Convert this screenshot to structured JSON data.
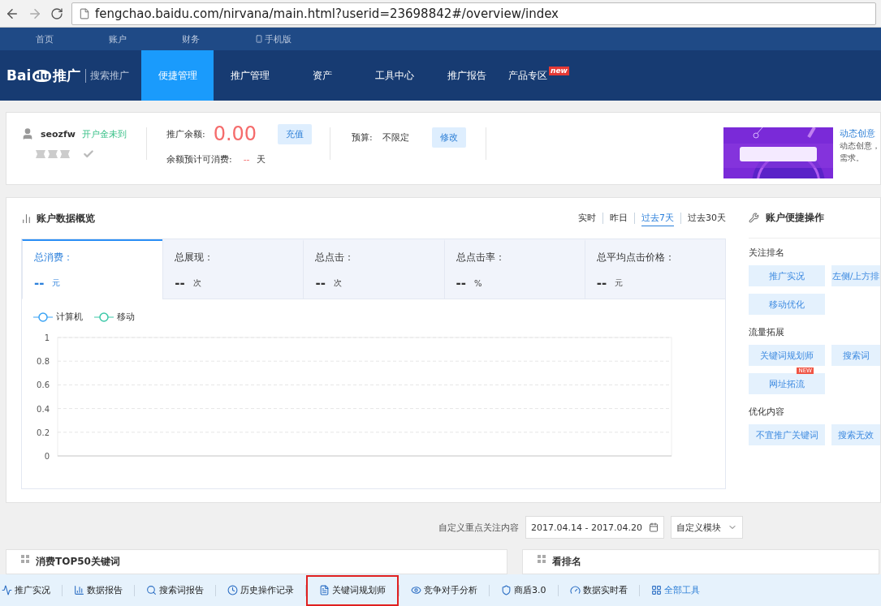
{
  "browser": {
    "url": "fengchao.baidu.com/nirvana/main.html?userid=23698842#/overview/index"
  },
  "top_links": [
    {
      "label": "首页",
      "kind": "text"
    },
    {
      "label": "账户",
      "kind": "text"
    },
    {
      "label": "财务",
      "kind": "text"
    },
    {
      "label": "手机版",
      "kind": "phone"
    }
  ],
  "logo": {
    "part_1": "Bai",
    "part_2": "du",
    "part_3": "推广",
    "subtitle": "搜索推广"
  },
  "nav_tabs": [
    {
      "label": "便捷管理",
      "selected": true
    },
    {
      "label": "推广管理",
      "selected": false
    },
    {
      "label": "资产",
      "selected": false
    },
    {
      "label": "工具中心",
      "selected": false
    },
    {
      "label": "推广报告",
      "selected": false
    },
    {
      "label": "产品专区",
      "selected": false,
      "badge": "new"
    }
  ],
  "account": {
    "username": "seozfw",
    "status": "开户金未到",
    "balance_label": "推广余额:",
    "balance": "0.00",
    "recharge_button": "充值",
    "estimate_label": "余额预计可消费:",
    "estimate_value": "--",
    "estimate_unit": "天",
    "budget_label": "预算:",
    "budget_value": "不限定",
    "edit_button": "修改"
  },
  "promo": {
    "title": "动态创意",
    "line_1": "动态创意，",
    "line_2": "需求。"
  },
  "overview": {
    "title": "账户数据概览",
    "time_ranges": [
      {
        "label": "实时",
        "selected": false
      },
      {
        "label": "昨日",
        "selected": false
      },
      {
        "label": "过去7天",
        "selected": true
      },
      {
        "label": "过去30天",
        "selected": false
      }
    ],
    "metrics": [
      {
        "label": "总消费：",
        "value": "--",
        "unit": "元",
        "selected": true
      },
      {
        "label": "总展现：",
        "value": "--",
        "unit": "次",
        "selected": false
      },
      {
        "label": "总点击：",
        "value": "--",
        "unit": "次",
        "selected": false
      },
      {
        "label": "总点击率：",
        "value": "--",
        "unit": "%",
        "selected": false
      },
      {
        "label": "总平均点击价格：",
        "value": "--",
        "unit": "元",
        "selected": false
      }
    ],
    "legend": [
      {
        "label": "计算机",
        "color": "#3aa3f5"
      },
      {
        "label": "移动",
        "color": "#3cc8a8"
      }
    ],
    "chart": {
      "y_labels": [
        "1",
        "0.8",
        "0.6",
        "0.4",
        "0.2",
        "0"
      ]
    }
  },
  "quick_ops": {
    "title": "账户便捷操作",
    "groups": [
      {
        "title": "关注排名",
        "buttons": [
          {
            "label": "推广实况"
          },
          {
            "label": "左侧/上方排"
          },
          {
            "label": "移动优化"
          }
        ]
      },
      {
        "title": "流量拓展",
        "buttons": [
          {
            "label": "关键词规划师"
          },
          {
            "label": "搜索词"
          },
          {
            "label": "网址拓流",
            "badge": "NEW"
          }
        ]
      },
      {
        "title": "优化内容",
        "buttons": [
          {
            "label": "不宜推广关键词"
          },
          {
            "label": "搜索无效"
          }
        ]
      }
    ]
  },
  "focus_bar": {
    "label": "自定义重点关注内容",
    "date_range": "2017.04.14 - 2017.04.20",
    "module_button": "自定义模块"
  },
  "cards": [
    {
      "title": "消费TOP50关键词"
    },
    {
      "title": "看排名"
    }
  ],
  "toolbar": [
    {
      "label": "推广实况",
      "highlighted": false
    },
    {
      "label": "数据报告",
      "highlighted": false
    },
    {
      "label": "搜索词报告",
      "highlighted": false
    },
    {
      "label": "历史操作记录",
      "highlighted": false
    },
    {
      "label": "关键词规划师",
      "highlighted": true
    },
    {
      "label": "竞争对手分析",
      "highlighted": false
    },
    {
      "label": "商盾3.0",
      "highlighted": false
    },
    {
      "label": "数据实时看",
      "highlighted": false
    },
    {
      "label": "全部工具",
      "highlighted": false,
      "kind": "link"
    }
  ]
}
